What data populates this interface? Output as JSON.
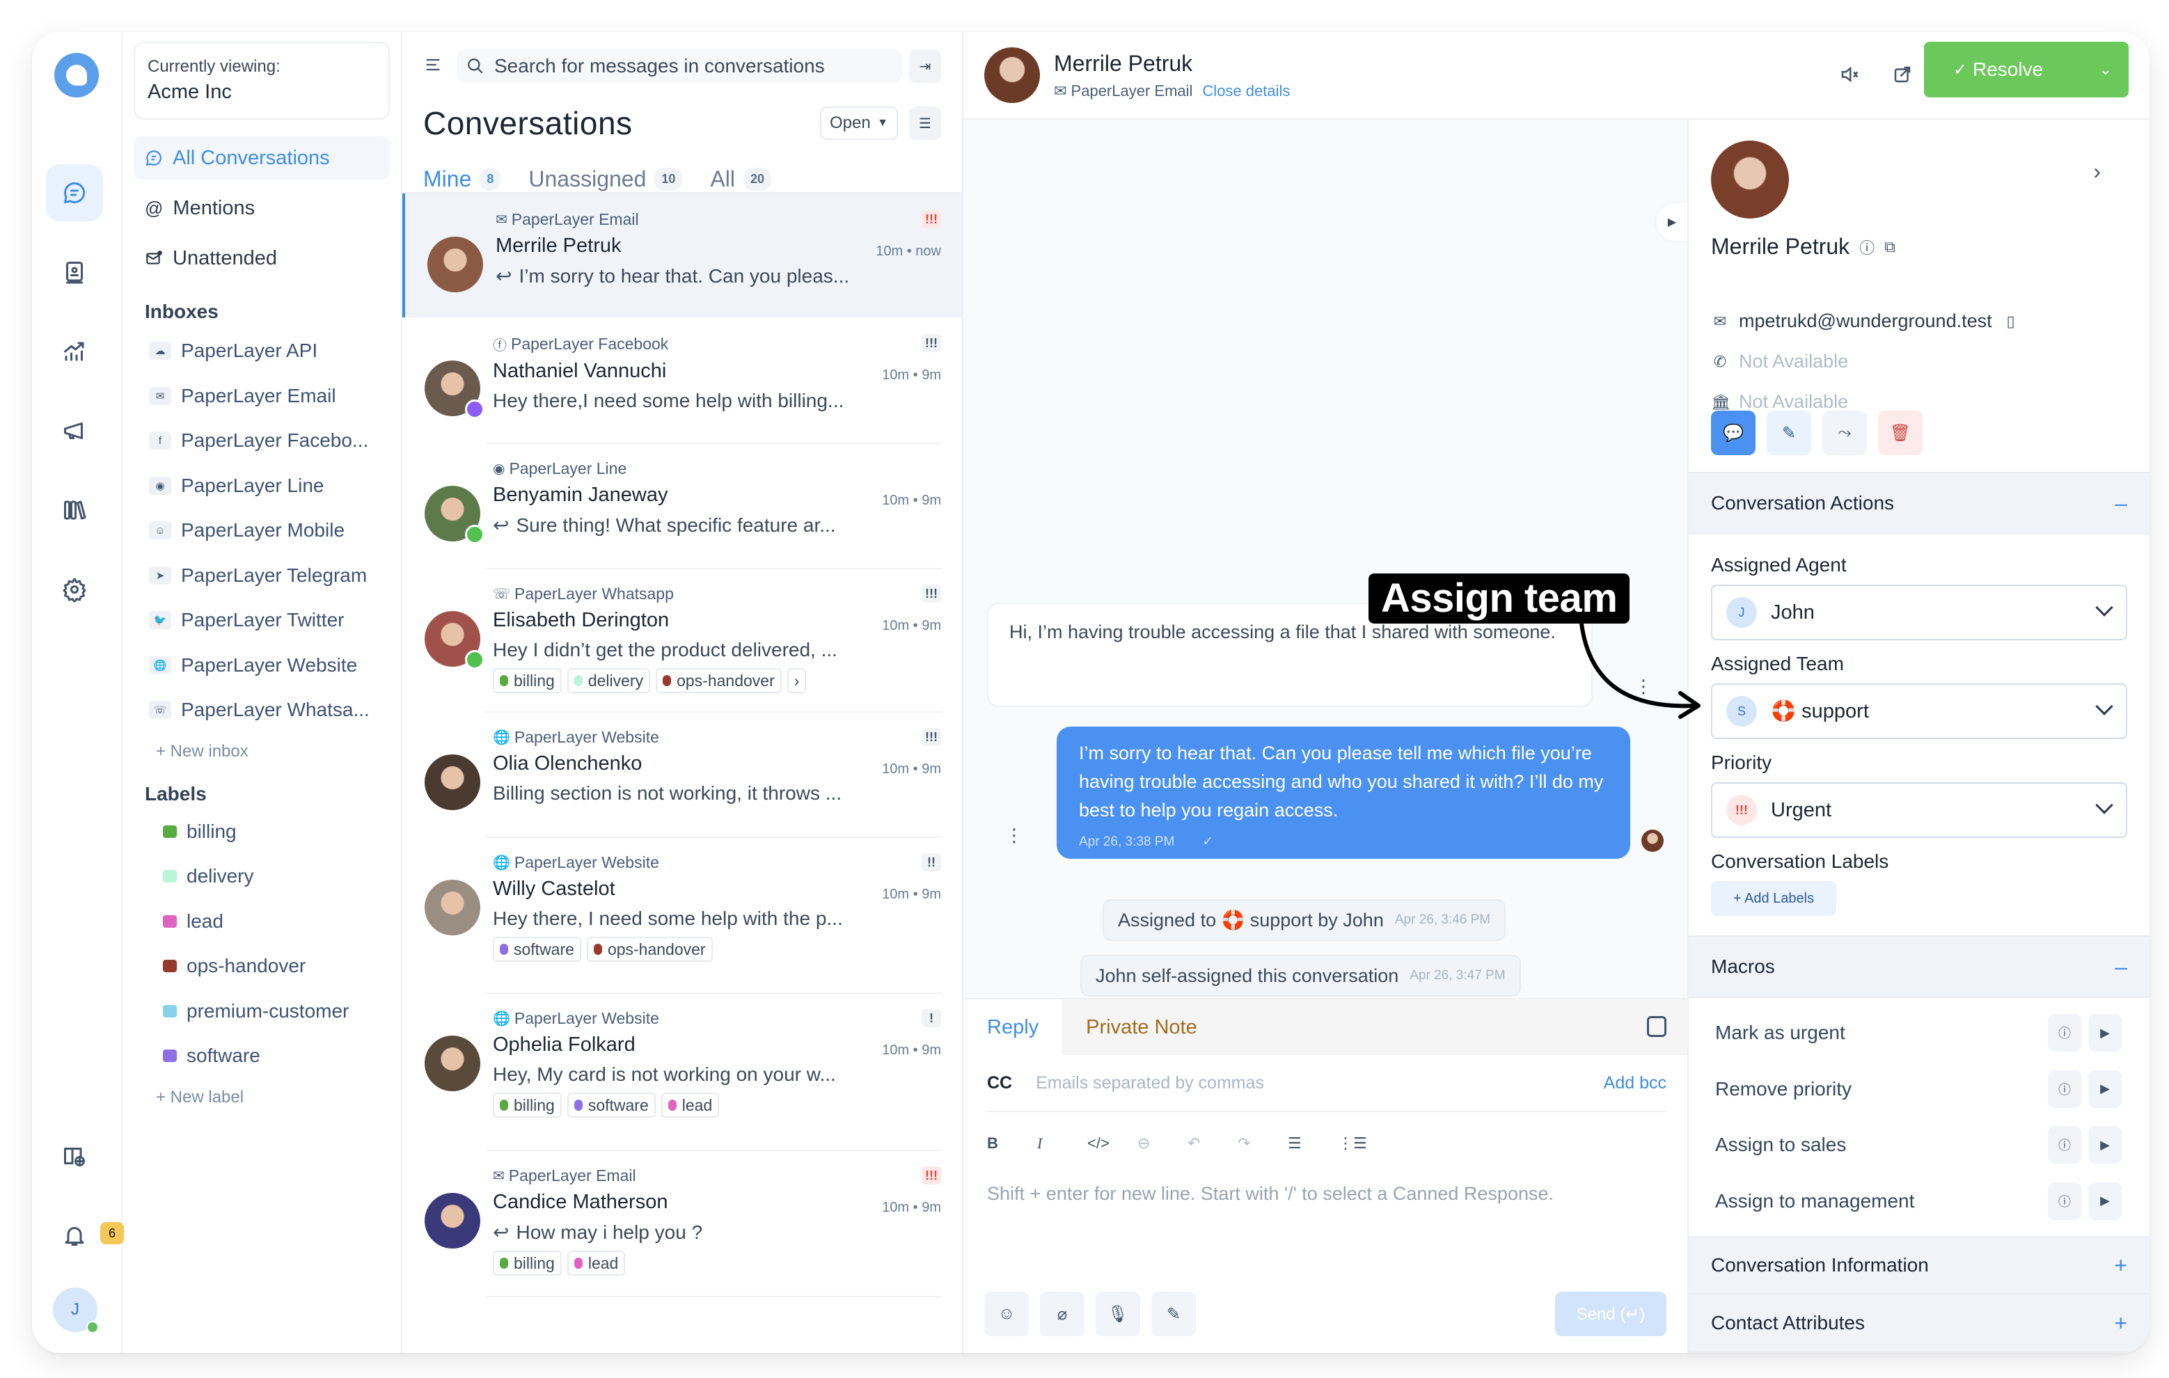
{
  "rail": {
    "items": [
      "conversations",
      "contacts",
      "reports",
      "campaigns",
      "library",
      "settings"
    ],
    "notification_count": "6",
    "user_initial": "J"
  },
  "sidebar": {
    "viewing_caption": "Currently viewing:",
    "org_name": "Acme Inc",
    "nav": [
      {
        "label": "All Conversations",
        "icon": "chat-bubble-icon",
        "active": true
      },
      {
        "label": "Mentions",
        "icon": "at-icon"
      },
      {
        "label": "Unattended",
        "icon": "mail-dot-icon"
      }
    ],
    "inboxes_title": "Inboxes",
    "inboxes": [
      {
        "label": "PaperLayer API",
        "icon": "cloud-icon",
        "glyph": "☁"
      },
      {
        "label": "PaperLayer Email",
        "icon": "mail-icon",
        "glyph": "✉"
      },
      {
        "label": "PaperLayer Facebo...",
        "icon": "facebook-icon",
        "glyph": "f"
      },
      {
        "label": "PaperLayer Line",
        "icon": "line-icon",
        "glyph": "◉"
      },
      {
        "label": "PaperLayer Mobile",
        "icon": "chat-icon",
        "glyph": "☺"
      },
      {
        "label": "PaperLayer Telegram",
        "icon": "telegram-icon",
        "glyph": "➤"
      },
      {
        "label": "PaperLayer Twitter",
        "icon": "twitter-icon",
        "glyph": "🐦"
      },
      {
        "label": "PaperLayer Website",
        "icon": "globe-icon",
        "glyph": "🌐"
      },
      {
        "label": "PaperLayer Whatsa...",
        "icon": "whatsapp-icon",
        "glyph": "☏"
      }
    ],
    "new_inbox": "+ New inbox",
    "labels_title": "Labels",
    "labels": [
      {
        "label": "billing",
        "color": "#57ab3f"
      },
      {
        "label": "delivery",
        "color": "#b9f5d6"
      },
      {
        "label": "lead",
        "color": "#e063c0"
      },
      {
        "label": "ops-handover",
        "color": "#963a2d"
      },
      {
        "label": "premium-customer",
        "color": "#86d2ea"
      },
      {
        "label": "software",
        "color": "#8d6fe6"
      }
    ],
    "new_label": "+ New label"
  },
  "list": {
    "search_placeholder": "Search for messages in conversations",
    "title": "Conversations",
    "status_filter": "Open",
    "tabs": [
      {
        "label": "Mine",
        "count": "8",
        "active": true
      },
      {
        "label": "Unassigned",
        "count": "10"
      },
      {
        "label": "All",
        "count": "20"
      }
    ],
    "conversations": [
      {
        "inbox": "PaperLayer Email",
        "inbox_glyph": "✉",
        "name": "Merrile Petruk",
        "time": "10m • now",
        "message": "I’m sorry to hear that. Can you pleas...",
        "reply": true,
        "priority": "!!!",
        "priority_level": "urgent",
        "labels": [],
        "avatar_color": "#8a5a44"
      },
      {
        "inbox": "PaperLayer Facebook",
        "inbox_glyph": "ⓕ",
        "name": "Nathaniel Vannuchi",
        "time": "10m • 9m",
        "message": "Hey there,I need some help with billing...",
        "reply": false,
        "priority": "!!!",
        "priority_level": "high",
        "labels": [],
        "avatar_color": "#6b5a4e",
        "channel_badge": "messenger"
      },
      {
        "inbox": "PaperLayer Line",
        "inbox_glyph": "◉",
        "name": "Benyamin Janeway",
        "time": "10m • 9m",
        "message": "Sure thing! What specific feature ar...",
        "reply": true,
        "priority": "",
        "labels": [],
        "avatar_color": "#5c7a4a",
        "channel_badge": "line"
      },
      {
        "inbox": "PaperLayer Whatsapp",
        "inbox_glyph": "☏",
        "name": "Elisabeth Derington",
        "time": "10m • 9m",
        "message": "Hey I didn’t get the product delivered, ...",
        "reply": false,
        "priority": "!!!",
        "priority_level": "high",
        "labels": [
          {
            "label": "billing",
            "color": "#57ab3f"
          },
          {
            "label": "delivery",
            "color": "#b9f5d6"
          },
          {
            "label": "ops-handover",
            "color": "#963a2d"
          }
        ],
        "more_labels": true,
        "avatar_color": "#a0524a",
        "channel_badge": "whatsapp"
      },
      {
        "inbox": "PaperLayer Website",
        "inbox_glyph": "🌐",
        "name": "Olia Olenchenko",
        "time": "10m • 9m",
        "message": "Billing section is not working, it throws ...",
        "reply": false,
        "priority": "!!!",
        "priority_level": "high",
        "labels": [],
        "avatar_color": "#4a3a30"
      },
      {
        "inbox": "PaperLayer Website",
        "inbox_glyph": "🌐",
        "name": "Willy Castelot",
        "time": "10m • 9m",
        "message": "Hey there, I need some help with the p...",
        "reply": false,
        "priority": "!!",
        "priority_level": "medium",
        "labels": [
          {
            "label": "software",
            "color": "#8d6fe6"
          },
          {
            "label": "ops-handover",
            "color": "#963a2d"
          }
        ],
        "avatar_color": "#9a8d82"
      },
      {
        "inbox": "PaperLayer Website",
        "inbox_glyph": "🌐",
        "name": "Ophelia Folkard",
        "time": "10m • 9m",
        "message": "Hey, My card is not working on your w...",
        "reply": false,
        "priority": "!",
        "priority_level": "low",
        "labels": [
          {
            "label": "billing",
            "color": "#57ab3f"
          },
          {
            "label": "software",
            "color": "#8d6fe6"
          },
          {
            "label": "lead",
            "color": "#e063c0"
          }
        ],
        "avatar_color": "#5a4a3a"
      },
      {
        "inbox": "PaperLayer Email",
        "inbox_glyph": "✉",
        "name": "Candice Matherson",
        "time": "10m • 9m",
        "message": "How may i help you ?",
        "reply": true,
        "priority": "!!!",
        "priority_level": "urgent",
        "labels": [
          {
            "label": "billing",
            "color": "#57ab3f"
          },
          {
            "label": "lead",
            "color": "#e063c0"
          }
        ],
        "avatar_color": "#3a3a7a"
      }
    ]
  },
  "chat": {
    "contact_name": "Merrile Petruk",
    "inbox": "PaperLayer Email",
    "close_details": "Close details",
    "resolve_label": "Resolve",
    "incoming_message": "Hi, I’m having trouble accessing a file that I shared with someone.",
    "outgoing_message": "I’m sorry to hear that. Can you please tell me which file you’re having trouble accessing and who you shared it with? I’ll do my best to help you regain access.",
    "outgoing_time": "Apr 26, 3:38 PM",
    "activities": [
      {
        "text": "Assigned to 🛟 support by John",
        "time": "Apr 26, 3:46 PM"
      },
      {
        "text": "John self-assigned this conversation",
        "time": "Apr 26, 3:47 PM"
      }
    ],
    "annotation": "Assign team",
    "composer": {
      "tab_reply": "Reply",
      "tab_note": "Private Note",
      "cc_label": "CC",
      "cc_placeholder": "Emails separated by commas",
      "add_bcc": "Add bcc",
      "editor_placeholder": "Shift + enter for new line. Start with '/' to select a Canned Response.",
      "send_label": "Send (↵)"
    }
  },
  "contact": {
    "name": "Merrile Petruk",
    "email": "mpetrukd@wunderground.test",
    "phone": "Not Available",
    "company": "Not Available"
  },
  "actions": {
    "title": "Conversation Actions",
    "assigned_agent_label": "Assigned Agent",
    "assigned_agent": "John",
    "agent_initial": "J",
    "assigned_team_label": "Assigned Team",
    "assigned_team": "🛟 support",
    "team_initial": "S",
    "priority_label": "Priority",
    "priority": "Urgent",
    "priority_glyph": "!!!",
    "labels_label": "Conversation Labels",
    "add_labels": "+ Add Labels"
  },
  "macros": {
    "title": "Macros",
    "items": [
      "Mark as urgent",
      "Remove priority",
      "Assign to sales",
      "Assign to management"
    ]
  },
  "sections": {
    "conversation_information": "Conversation Information",
    "contact_attributes": "Contact Attributes"
  }
}
